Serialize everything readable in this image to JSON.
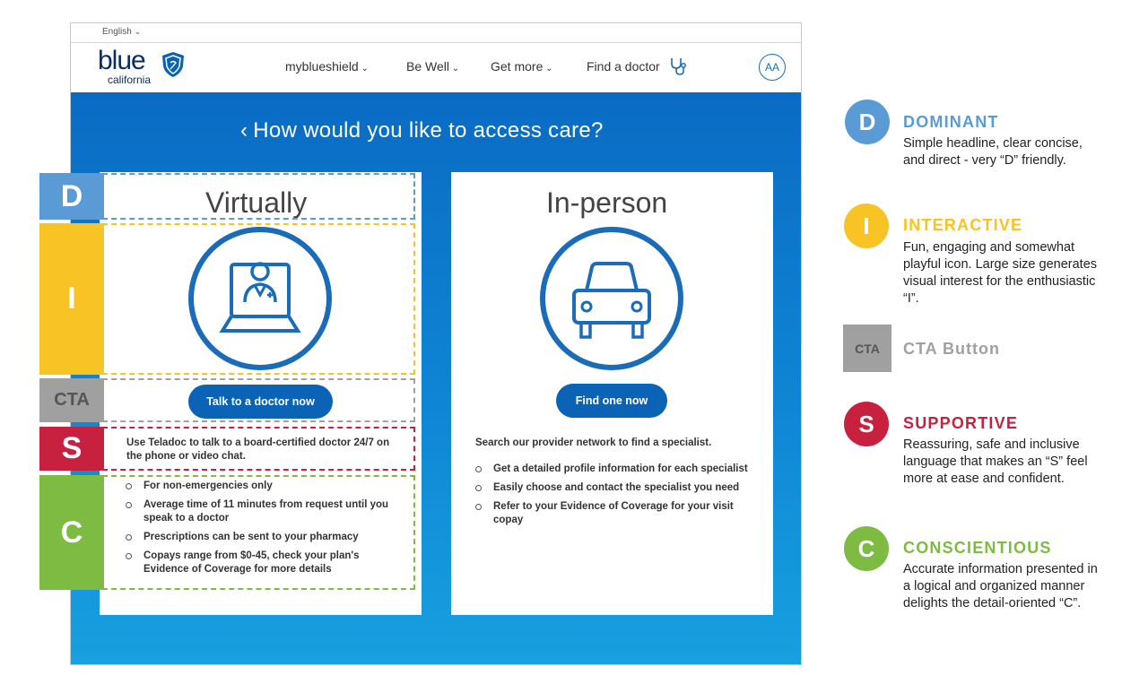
{
  "site": {
    "language": "English",
    "logo": {
      "word": "blue",
      "sub": "california"
    },
    "nav": [
      "myblueshield",
      "Be Well",
      "Get more",
      "Find a doctor"
    ],
    "avatar": "AA"
  },
  "headline": "How would you like to access care?",
  "cards": {
    "virtual": {
      "title": "Virtually",
      "button": "Talk to a doctor now",
      "description": "Use Teladoc to talk to a board-certified doctor 24/7 on the phone or video chat.",
      "bullets": [
        "For non-emergencies only",
        "Average time of 11 minutes from request until you speak to a doctor",
        "Prescriptions can be sent to your pharmacy",
        "Copays range from $0-45, check your plan's Evidence of Coverage for more details"
      ]
    },
    "inperson": {
      "title": "In-person",
      "button": "Find one now",
      "description": "Search our provider network to find a specialist.",
      "bullets": [
        "Get a detailed profile information for each specialist",
        "Easily choose and contact the specialist you need",
        "Refer to your Evidence of Coverage for your visit copay"
      ]
    }
  },
  "tabs": {
    "d": "D",
    "i": "I",
    "cta": "CTA",
    "s": "S",
    "c": "C"
  },
  "legend": [
    {
      "letter": "D",
      "title": "DOMINANT",
      "text": "Simple headline, clear concise, and direct - very “D” friendly.",
      "color": "#5b9bd5"
    },
    {
      "letter": "I",
      "title": "INTERACTIVE",
      "text": "Fun, engaging and somewhat playful icon. Large size generates visual interest for the enthusiastic “I”.",
      "color": "#f7c325"
    },
    {
      "letter": "CTA",
      "title": "CTA Button",
      "text": "",
      "color": "#a0a0a0"
    },
    {
      "letter": "S",
      "title": "SUPPORTIVE",
      "text": "Reassuring, safe and inclusive language that makes an “S” feel more at ease and confident.",
      "color": "#c8203f"
    },
    {
      "letter": "C",
      "title": "CONSCIENTIOUS",
      "text": "Accurate information presented in a logical and organized manner delights the detail-oriented “C”.",
      "color": "#7dbb42"
    }
  ],
  "colors": {
    "primary": "#0a63b4",
    "d": "#5b9bd5",
    "i": "#f7c325",
    "cta": "#a0a0a0",
    "s": "#c8203f",
    "c": "#7dbb42"
  }
}
